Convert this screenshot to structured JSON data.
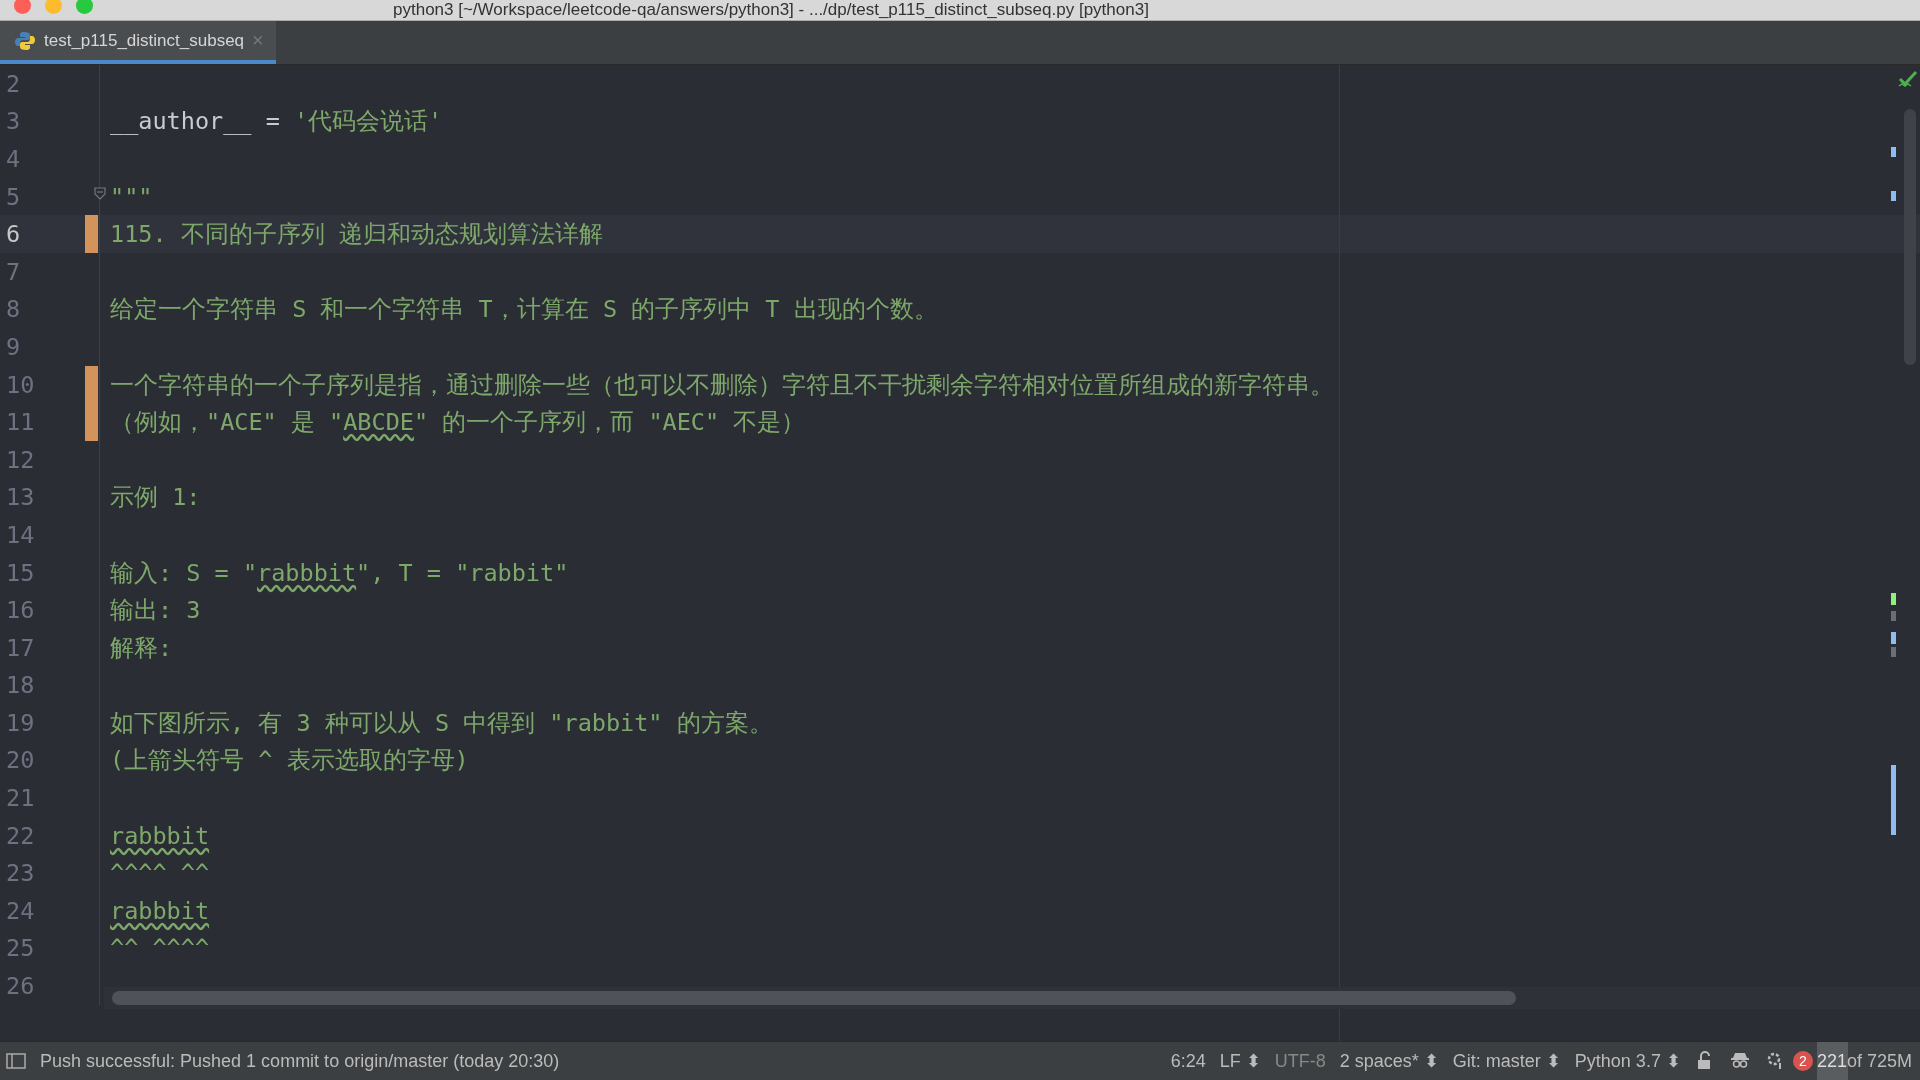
{
  "window": {
    "title": "python3 [~/Workspace/leetcode-qa/answers/python3] - .../dp/test_p115_distinct_subseq.py [python3]"
  },
  "tabs": [
    {
      "label": "test_p115_distinct_subseq",
      "selected": true,
      "close": "×"
    }
  ],
  "editor": {
    "lines": [
      {
        "number": "2",
        "current": false,
        "modified": false
      },
      {
        "number": "3",
        "current": false,
        "modified": false,
        "segments": [
          {
            "text": "__author__ = ",
            "kind": "code",
            "typo": false
          },
          {
            "text": "'代码会说话'",
            "kind": "string",
            "typo": false
          }
        ]
      },
      {
        "number": "4",
        "current": false,
        "modified": false
      },
      {
        "number": "5",
        "current": false,
        "modified": false,
        "fold": true,
        "segments": [
          {
            "text": "\"\"\"",
            "kind": "string",
            "typo": false
          }
        ]
      },
      {
        "number": "6",
        "current": true,
        "modified": true,
        "segments": [
          {
            "text": "115. 不同的子序列 递归和动态规划算法详解",
            "kind": "string",
            "typo": false
          }
        ]
      },
      {
        "number": "7",
        "current": false,
        "modified": false
      },
      {
        "number": "8",
        "current": false,
        "modified": false,
        "segments": [
          {
            "text": "给定一个字符串 S 和一个字符串 T，计算在 S 的子序列中 T 出现的个数。",
            "kind": "string",
            "typo": false
          }
        ]
      },
      {
        "number": "9",
        "current": false,
        "modified": false
      },
      {
        "number": "10",
        "current": false,
        "modified": true,
        "segments": [
          {
            "text": "一个字符串的一个子序列是指，通过删除一些（也可以不删除）字符且不干扰剩余字符相对位置所组成的新字符串。",
            "kind": "string",
            "typo": false
          }
        ]
      },
      {
        "number": "11",
        "current": false,
        "modified": true,
        "segments": [
          {
            "text": "（例如，\"ACE\" 是 \"",
            "kind": "string",
            "typo": false
          },
          {
            "text": "ABCDE",
            "kind": "string",
            "typo": true
          },
          {
            "text": "\" 的一个子序列，而 \"AEC\" 不是）",
            "kind": "string",
            "typo": false
          }
        ]
      },
      {
        "number": "12",
        "current": false,
        "modified": false
      },
      {
        "number": "13",
        "current": false,
        "modified": false,
        "segments": [
          {
            "text": "示例 1:",
            "kind": "string",
            "typo": false
          }
        ]
      },
      {
        "number": "14",
        "current": false,
        "modified": false
      },
      {
        "number": "15",
        "current": false,
        "modified": false,
        "segments": [
          {
            "text": "输入: S = \"",
            "kind": "string",
            "typo": false
          },
          {
            "text": "rabbbit",
            "kind": "string",
            "typo": true
          },
          {
            "text": "\", T = \"rabbit\"",
            "kind": "string",
            "typo": false
          }
        ]
      },
      {
        "number": "16",
        "current": false,
        "modified": false,
        "segments": [
          {
            "text": "输出: 3",
            "kind": "string",
            "typo": false
          }
        ]
      },
      {
        "number": "17",
        "current": false,
        "modified": false,
        "segments": [
          {
            "text": "解释:",
            "kind": "string",
            "typo": false
          }
        ]
      },
      {
        "number": "18",
        "current": false,
        "modified": false
      },
      {
        "number": "19",
        "current": false,
        "modified": false,
        "segments": [
          {
            "text": "如下图所示, 有 3 种可以从 S 中得到 \"rabbit\" 的方案。",
            "kind": "string",
            "typo": false
          }
        ]
      },
      {
        "number": "20",
        "current": false,
        "modified": false,
        "segments": [
          {
            "text": "(上箭头符号 ^ 表示选取的字母)",
            "kind": "string",
            "typo": false
          }
        ]
      },
      {
        "number": "21",
        "current": false,
        "modified": false
      },
      {
        "number": "22",
        "current": false,
        "modified": false,
        "segments": [
          {
            "text": "rabbbit",
            "kind": "string",
            "typo": true
          }
        ]
      },
      {
        "number": "23",
        "current": false,
        "modified": false,
        "segments": [
          {
            "text": "^^^^ ^^",
            "kind": "string",
            "typo": false
          }
        ]
      },
      {
        "number": "24",
        "current": false,
        "modified": false,
        "segments": [
          {
            "text": "rabbbit",
            "kind": "string",
            "typo": true
          }
        ]
      },
      {
        "number": "25",
        "current": false,
        "modified": false,
        "segments": [
          {
            "text": "^^ ^^^^",
            "kind": "string",
            "typo": false
          }
        ]
      },
      {
        "number": "26",
        "current": false,
        "modified": false
      }
    ],
    "stripe_marks": [
      {
        "color": "#8fbdf2"
      },
      {
        "color": "#8fbdf2"
      },
      {
        "color": "#8ff27a"
      },
      {
        "color": "#6b6e75"
      },
      {
        "color": "#8fbdf2"
      },
      {
        "color": "#6b6e75"
      },
      {
        "color": "#8fbdf2"
      }
    ]
  },
  "status_bar": {
    "message": "Push successful: Pushed 1 commit to origin/master (today 20:30)",
    "items": [
      {
        "text": "6:24",
        "dropdown": false,
        "dim": false
      },
      {
        "text": "LF",
        "dropdown": true,
        "dim": false
      },
      {
        "text": "UTF-8",
        "dropdown": false,
        "dim": true
      },
      {
        "text": "2 spaces*",
        "dropdown": true,
        "dim": false
      },
      {
        "text": "Git: master",
        "dropdown": true,
        "dim": false
      },
      {
        "text": "Python 3.7",
        "dropdown": true,
        "dim": false
      }
    ],
    "updown": "⬍",
    "notifications": "2",
    "memory": {
      "used": "221",
      "total": " of 725M",
      "level": 0.3
    }
  }
}
